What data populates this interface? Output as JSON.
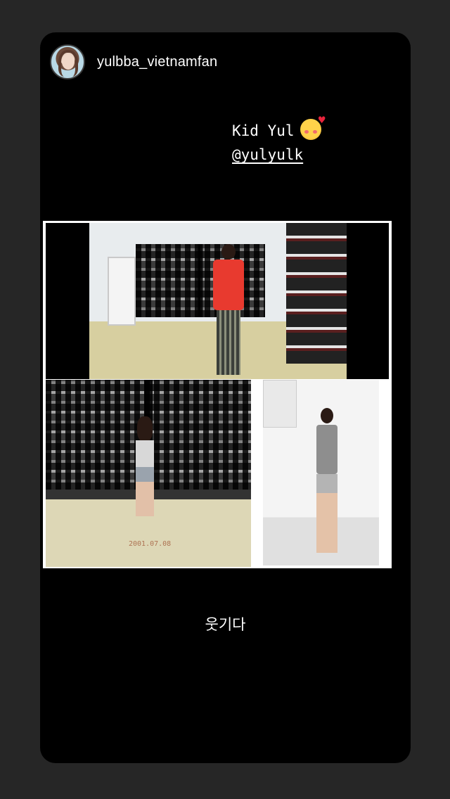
{
  "story": {
    "username": "yulbba_vietnamfan",
    "overlay_line1": "Kid Yul",
    "overlay_emoji": "smiling-face-with-hearts-icon",
    "overlay_line2": "@yulyulk",
    "caption": "웃기다"
  },
  "media": {
    "clip_bottom_left_timestamp": "2001.07.08"
  },
  "colors": {
    "background": "#262626",
    "card": "#000000",
    "text": "#ffffff"
  }
}
